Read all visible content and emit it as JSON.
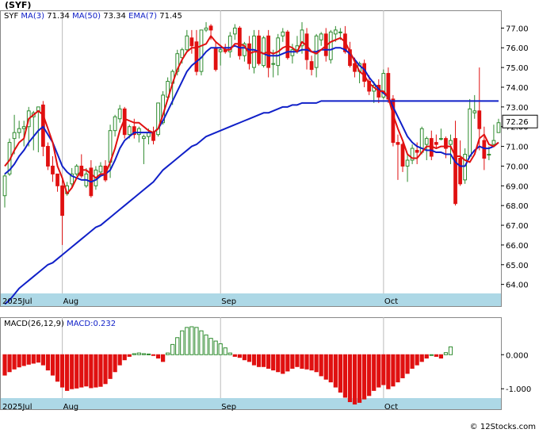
{
  "chart_data": [
    {
      "type": "candlestick",
      "title": "(SYF)",
      "legend": {
        "symbol": "SYF",
        "ma3_label": "MA(3)",
        "ma3_value": "71.34",
        "ma50_label": "MA(50)",
        "ma50_value": "73.34",
        "ema7_label": "EMA(7)",
        "ema7_value": "71.45"
      },
      "last_price_label": "72.26",
      "last_price": 72.26,
      "y_ticks": [
        "77.00",
        "76.00",
        "75.00",
        "74.00",
        "73.00",
        "72.00",
        "71.00",
        "70.00",
        "69.00",
        "68.00",
        "67.00",
        "66.00",
        "65.00",
        "64.00"
      ],
      "ylim": [
        62.9,
        77.9
      ],
      "x_month_labels": [
        {
          "label": "2025Jul",
          "index": 0
        },
        {
          "label": "Aug",
          "index": 13
        },
        {
          "label": "Sep",
          "index": 46
        },
        {
          "label": "Oct",
          "index": 80
        }
      ],
      "colors": {
        "up": "#2e8b2e",
        "down": "#e01010",
        "ma3": "#e01010",
        "ma50": "#1020c8",
        "ema7": "#1020c8",
        "axisband": "#add8e6"
      },
      "candles": [
        [
          68.5,
          69.6,
          67.9,
          69.5
        ],
        [
          69.6,
          71.4,
          69.5,
          71.2
        ],
        [
          71.4,
          72.6,
          70.6,
          71.7
        ],
        [
          71.7,
          72.3,
          71.4,
          71.9
        ],
        [
          71.9,
          72.3,
          71.0,
          72.0
        ],
        [
          72.0,
          73.0,
          71.0,
          72.8
        ],
        [
          72.5,
          72.8,
          70.8,
          72.7
        ],
        [
          72.8,
          72.9,
          70.7,
          73.0
        ],
        [
          73.1,
          73.3,
          70.5,
          71.0
        ],
        [
          71.0,
          71.2,
          69.8,
          70.0
        ],
        [
          70.0,
          70.5,
          69.2,
          69.6
        ],
        [
          69.6,
          69.4,
          68.7,
          69.0
        ],
        [
          69.0,
          69.3,
          66.0,
          67.5
        ],
        [
          68.6,
          69.2,
          68.5,
          69.0
        ],
        [
          69.1,
          69.9,
          68.9,
          69.6
        ],
        [
          69.6,
          70.1,
          69.5,
          70.0
        ],
        [
          70.0,
          70.6,
          69.4,
          69.5
        ],
        [
          69.0,
          69.9,
          68.9,
          69.6
        ],
        [
          69.9,
          70.3,
          68.4,
          68.5
        ],
        [
          69.0,
          70.0,
          68.8,
          69.8
        ],
        [
          69.7,
          70.2,
          69.5,
          70.0
        ],
        [
          70.0,
          70.3,
          69.2,
          69.3
        ],
        [
          70.2,
          72.1,
          69.4,
          71.8
        ],
        [
          71.8,
          72.6,
          71.5,
          72.5
        ],
        [
          72.4,
          73.1,
          72.2,
          72.9
        ],
        [
          72.9,
          73.0,
          71.4,
          71.6
        ],
        [
          71.6,
          72.1,
          71.4,
          72.0
        ],
        [
          72.0,
          72.4,
          71.4,
          71.6
        ],
        [
          71.6,
          72.0,
          71.2,
          71.9
        ],
        [
          71.4,
          71.6,
          70.1,
          71.5
        ],
        [
          71.5,
          71.9,
          71.1,
          71.7
        ],
        [
          71.7,
          72.0,
          71.1,
          71.3
        ],
        [
          71.6,
          73.2,
          71.5,
          73.2
        ],
        [
          72.2,
          73.8,
          72.1,
          73.6
        ],
        [
          73.5,
          74.5,
          73.4,
          74.3
        ],
        [
          74.2,
          74.9,
          73.1,
          74.8
        ],
        [
          74.8,
          75.9,
          74.6,
          75.7
        ],
        [
          75.5,
          76.0,
          75.2,
          75.9
        ],
        [
          75.9,
          76.9,
          75.8,
          76.6
        ],
        [
          76.5,
          76.9,
          75.7,
          76.1
        ],
        [
          76.3,
          76.9,
          74.6,
          74.8
        ],
        [
          74.8,
          76.9,
          74.6,
          76.9
        ],
        [
          76.9,
          77.3,
          76.8,
          77.0
        ],
        [
          77.1,
          77.2,
          76.4,
          76.9
        ],
        [
          76.0,
          76.3,
          74.8,
          74.9
        ],
        [
          75.8,
          76.0,
          75.1,
          75.9
        ],
        [
          75.9,
          76.2,
          75.7,
          75.8
        ],
        [
          75.8,
          76.8,
          75.5,
          76.6
        ],
        [
          76.7,
          77.2,
          76.4,
          77.0
        ],
        [
          77.0,
          77.1,
          75.4,
          75.6
        ],
        [
          75.6,
          76.3,
          75.3,
          76.2
        ],
        [
          76.2,
          76.6,
          74.9,
          75.2
        ],
        [
          75.0,
          76.9,
          74.7,
          76.6
        ],
        [
          76.6,
          76.9,
          75.1,
          75.2
        ],
        [
          75.1,
          76.6,
          75.0,
          76.5
        ],
        [
          76.6,
          76.9,
          74.5,
          75.0
        ],
        [
          75.2,
          75.9,
          74.5,
          75.2
        ],
        [
          75.1,
          76.7,
          74.6,
          76.5
        ],
        [
          76.6,
          77.0,
          76.3,
          76.8
        ],
        [
          76.8,
          76.9,
          75.4,
          75.5
        ],
        [
          75.6,
          76.2,
          75.2,
          75.9
        ],
        [
          75.9,
          76.6,
          75.7,
          76.1
        ],
        [
          76.1,
          77.3,
          75.7,
          76.9
        ],
        [
          76.7,
          77.0,
          74.9,
          75.4
        ],
        [
          75.3,
          75.6,
          74.6,
          74.9
        ],
        [
          75.0,
          76.7,
          74.5,
          76.6
        ],
        [
          76.4,
          76.8,
          76.1,
          76.7
        ],
        [
          76.7,
          77.0,
          75.3,
          75.6
        ],
        [
          75.4,
          76.9,
          75.2,
          76.8
        ],
        [
          76.7,
          77.1,
          76.3,
          76.9
        ],
        [
          76.8,
          77.0,
          76.4,
          76.8
        ],
        [
          76.7,
          77.1,
          75.7,
          75.8
        ],
        [
          75.9,
          76.3,
          75.0,
          75.1
        ],
        [
          75.2,
          75.5,
          74.5,
          74.8
        ],
        [
          74.8,
          75.3,
          74.2,
          75.2
        ],
        [
          75.2,
          75.4,
          74.0,
          74.3
        ],
        [
          74.3,
          74.6,
          73.6,
          73.8
        ],
        [
          73.8,
          74.3,
          73.2,
          74.1
        ],
        [
          74.1,
          74.4,
          73.2,
          73.5
        ],
        [
          73.5,
          74.9,
          73.4,
          74.7
        ],
        [
          74.7,
          75.0,
          73.2,
          73.4
        ],
        [
          73.4,
          73.6,
          71.0,
          71.2
        ],
        [
          71.2,
          71.6,
          69.3,
          71.1
        ],
        [
          71.1,
          71.2,
          69.7,
          70.0
        ],
        [
          70.0,
          70.6,
          69.2,
          70.3
        ],
        [
          70.3,
          71.1,
          70.1,
          70.9
        ],
        [
          70.8,
          71.2,
          70.1,
          70.7
        ],
        [
          70.7,
          72.0,
          70.6,
          71.9
        ],
        [
          71.1,
          71.5,
          70.3,
          71.4
        ],
        [
          71.4,
          71.8,
          70.3,
          70.5
        ],
        [
          71.2,
          71.6,
          70.9,
          71.1
        ],
        [
          71.4,
          71.9,
          71.3,
          71.4
        ],
        [
          71.4,
          71.5,
          70.4,
          70.9
        ],
        [
          71.1,
          71.6,
          70.1,
          71.3
        ],
        [
          71.4,
          72.3,
          68.0,
          68.1
        ],
        [
          70.4,
          71.3,
          69.0,
          69.1
        ],
        [
          69.3,
          70.9,
          69.1,
          70.6
        ],
        [
          70.5,
          73.4,
          70.4,
          72.9
        ],
        [
          72.7,
          73.6,
          72.4,
          72.8
        ],
        [
          72.8,
          75.0,
          70.8,
          71.9
        ],
        [
          71.3,
          72.0,
          69.8,
          70.4
        ],
        [
          70.6,
          71.0,
          70.3,
          70.6
        ],
        [
          71.1,
          72.1,
          71.0,
          71.3
        ],
        [
          71.7,
          72.4,
          71.8,
          72.2
        ]
      ],
      "ma3": [
        70.0,
        70.3,
        70.8,
        71.2,
        71.4,
        72.4,
        72.6,
        72.8,
        72.6,
        71.9,
        71.2,
        70.0,
        69.4,
        68.6,
        68.9,
        69.4,
        69.8,
        69.8,
        69.6,
        69.4,
        69.6,
        69.6,
        70.2,
        70.9,
        71.8,
        72.4,
        72.3,
        72.2,
        72.2,
        72.0,
        71.8,
        71.7,
        71.9,
        72.6,
        73.4,
        74.2,
        74.9,
        75.4,
        75.8,
        76.0,
        76.0,
        76.1,
        76.2,
        76.6,
        76.3,
        76.1,
        75.9,
        75.9,
        76.2,
        76.2,
        76.1,
        75.7,
        75.8,
        75.8,
        75.7,
        75.8,
        75.7,
        75.8,
        76.0,
        76.1,
        76.0,
        75.8,
        76.3,
        76.1,
        75.8,
        75.7,
        75.9,
        76.1,
        76.3,
        76.4,
        76.5,
        76.3,
        75.8,
        75.3,
        74.8,
        74.6,
        74.2,
        74.0,
        73.8,
        73.8,
        73.5,
        72.6,
        71.9,
        71.3,
        70.6,
        70.4,
        70.4,
        70.7,
        71.0,
        71.0,
        70.9,
        71.0,
        71.0,
        71.0,
        70.5,
        70.5,
        70.3,
        70.2,
        70.6,
        71.4,
        71.6,
        71.1,
        71.0,
        71.2
      ],
      "ma50": [
        63.0,
        63.2,
        63.5,
        63.8,
        64.0,
        64.2,
        64.4,
        64.6,
        64.8,
        65.0,
        65.1,
        65.3,
        65.5,
        65.7,
        65.9,
        66.1,
        66.3,
        66.5,
        66.7,
        66.9,
        67.0,
        67.2,
        67.4,
        67.6,
        67.8,
        68.0,
        68.2,
        68.4,
        68.6,
        68.8,
        69.0,
        69.2,
        69.5,
        69.8,
        70.0,
        70.2,
        70.4,
        70.6,
        70.8,
        71.0,
        71.1,
        71.3,
        71.5,
        71.6,
        71.7,
        71.8,
        71.9,
        72.0,
        72.1,
        72.2,
        72.3,
        72.4,
        72.5,
        72.6,
        72.7,
        72.7,
        72.8,
        72.9,
        73.0,
        73.0,
        73.1,
        73.1,
        73.2,
        73.2,
        73.2,
        73.2,
        73.3,
        73.3,
        73.3,
        73.3,
        73.3,
        73.3,
        73.3,
        73.3,
        73.3,
        73.3,
        73.3,
        73.3,
        73.3,
        73.3,
        73.3,
        73.3,
        73.3,
        73.3,
        73.3,
        73.3,
        73.3,
        73.3,
        73.3,
        73.3,
        73.3,
        73.3,
        73.3,
        73.3,
        73.3,
        73.3,
        73.3,
        73.3,
        73.3,
        73.3,
        73.3,
        73.3,
        73.3,
        73.3
      ],
      "ema7": [
        69.6,
        69.8,
        70.1,
        70.5,
        70.8,
        71.2,
        71.5,
        71.8,
        72.0,
        71.6,
        71.2,
        70.6,
        70.0,
        69.7,
        69.5,
        69.4,
        69.3,
        69.3,
        69.2,
        69.3,
        69.5,
        69.6,
        69.8,
        70.3,
        70.9,
        71.3,
        71.5,
        71.7,
        71.7,
        71.7,
        71.7,
        71.7,
        71.9,
        72.3,
        72.8,
        73.3,
        73.8,
        74.3,
        74.8,
        75.1,
        75.3,
        75.5,
        75.8,
        76.0,
        76.0,
        76.0,
        76.0,
        76.0,
        76.1,
        76.0,
        76.0,
        75.9,
        75.9,
        75.8,
        75.7,
        75.6,
        75.6,
        75.6,
        75.7,
        75.8,
        75.8,
        75.8,
        75.9,
        75.9,
        75.8,
        75.8,
        75.9,
        75.9,
        75.9,
        76.0,
        76.0,
        75.9,
        75.7,
        75.4,
        75.1,
        74.9,
        74.5,
        74.2,
        73.9,
        73.7,
        73.5,
        73.0,
        72.5,
        72.0,
        71.5,
        71.2,
        71.0,
        70.9,
        70.8,
        70.8,
        70.7,
        70.7,
        70.6,
        70.6,
        70.2,
        70.0,
        70.0,
        70.5,
        70.8,
        71.0,
        70.9,
        70.9,
        71.0,
        71.2
      ]
    },
    {
      "type": "bar",
      "title": "MACD(26,12,9)",
      "legend_label": "MACD(26,12,9)",
      "value_label": "MACD:0.232",
      "y_ticks": [
        "0.000",
        "-1.000"
      ],
      "ylim": [
        -1.6,
        1.1
      ],
      "values": [
        -0.6,
        -0.5,
        -0.42,
        -0.36,
        -0.32,
        -0.28,
        -0.25,
        -0.22,
        -0.3,
        -0.45,
        -0.6,
        -0.78,
        -0.95,
        -1.05,
        -1.0,
        -0.98,
        -0.95,
        -0.92,
        -0.97,
        -0.95,
        -0.93,
        -0.85,
        -0.7,
        -0.5,
        -0.3,
        -0.15,
        -0.05,
        0.03,
        0.05,
        0.03,
        0.02,
        -0.02,
        -0.1,
        -0.2,
        0.05,
        0.3,
        0.5,
        0.7,
        0.8,
        0.82,
        0.8,
        0.7,
        0.58,
        0.48,
        0.4,
        0.32,
        0.2,
        0.05,
        -0.05,
        -0.08,
        -0.15,
        -0.2,
        -0.3,
        -0.35,
        -0.35,
        -0.4,
        -0.45,
        -0.5,
        -0.55,
        -0.48,
        -0.4,
        -0.35,
        -0.4,
        -0.42,
        -0.45,
        -0.5,
        -0.62,
        -0.72,
        -0.8,
        -0.95,
        -1.1,
        -1.25,
        -1.38,
        -1.45,
        -1.4,
        -1.3,
        -1.2,
        -1.05,
        -0.95,
        -0.88,
        -1.0,
        -0.92,
        -0.8,
        -0.68,
        -0.55,
        -0.4,
        -0.3,
        -0.2,
        -0.1,
        0.0,
        -0.05,
        -0.1,
        0.06,
        0.23
      ]
    }
  ],
  "watermark": "© 12Stocks.com"
}
